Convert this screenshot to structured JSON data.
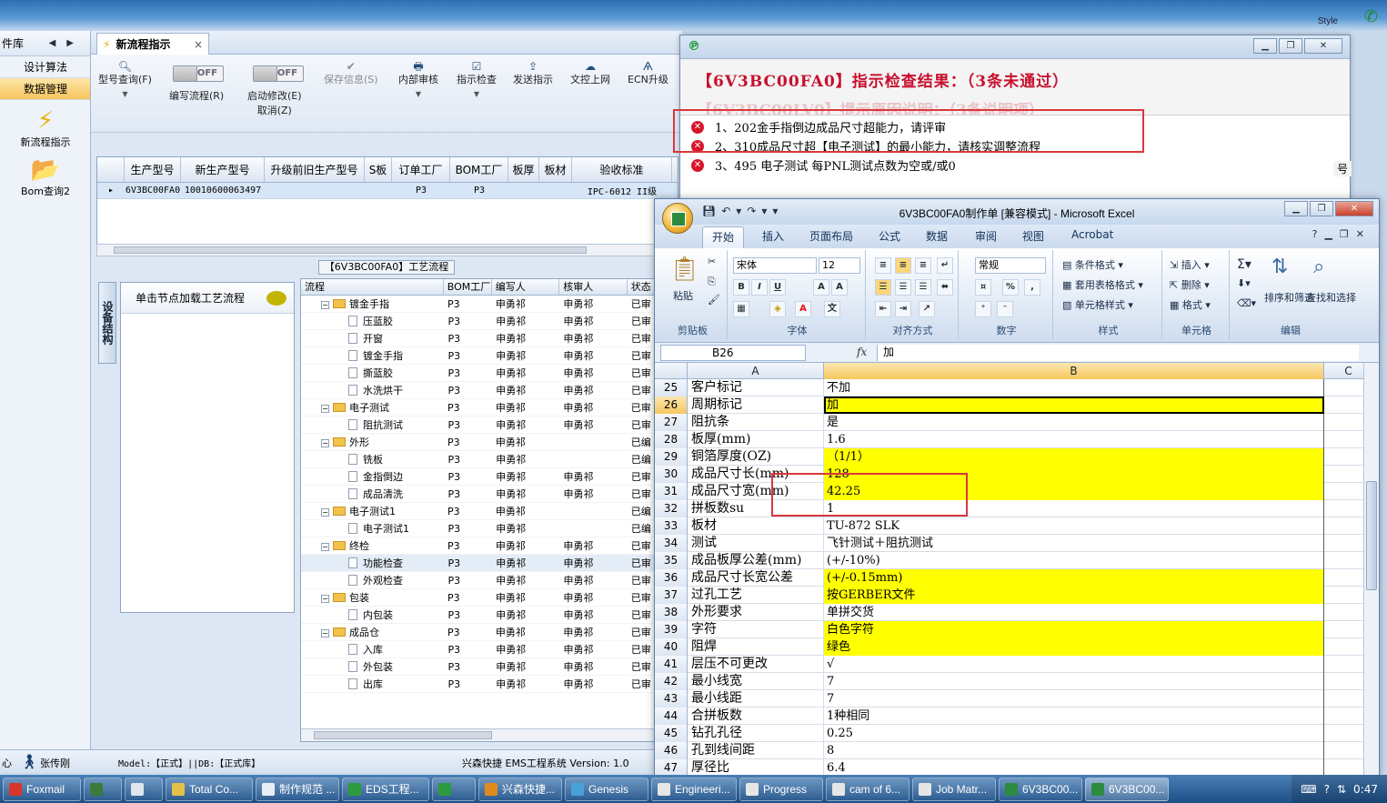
{
  "desktop": {
    "style_label": "Style"
  },
  "leftnav": {
    "header": "件库",
    "items": [
      {
        "label": "设计算法"
      },
      {
        "label": "数据管理"
      }
    ],
    "launchers": [
      {
        "label": "新流程指示"
      },
      {
        "label": "Bom查询2"
      }
    ]
  },
  "main": {
    "tab": {
      "label": "新流程指示",
      "close": "×"
    },
    "toolbar": {
      "model_query": "型号查询(F)",
      "write_flow": "编写流程(R)",
      "toggle_off": "OFF",
      "start_modify": "启动修改(E)",
      "cancel": "取消(Z)",
      "save_info": "保存信息(S)",
      "internal_review": "内部审核",
      "indication_check": "指示检查",
      "send_indication": "发送指示",
      "upload_doc": "文控上网",
      "ecn_upgrade": "ECN升级"
    },
    "upper_grid": {
      "columns": [
        "生产型号",
        "新生产型号",
        "升级前旧生产型号",
        "S板",
        "订单工厂",
        "BOM工厂",
        "板厚",
        "板材",
        "验收标准"
      ],
      "row": [
        "6V3BC00FA0",
        "10010600063497",
        "",
        "",
        "P3",
        "P3",
        "",
        "",
        "IPC-6012 II级"
      ]
    },
    "flow_title": "【6V3BC00FA0】工艺流程",
    "vtab_label": "设备结构",
    "node_hint": "单击节点加载工艺流程",
    "flow_columns": [
      "流程",
      "BOM工厂",
      "编写人",
      "核审人",
      "状态"
    ],
    "flow_rows": [
      {
        "name": "镀金手指",
        "level": 0,
        "bom": "P3",
        "writer": "申勇祁",
        "reviewer": "申勇祁",
        "status": "已审"
      },
      {
        "name": "压蓝胶",
        "level": 1,
        "bom": "P3",
        "writer": "申勇祁",
        "reviewer": "申勇祁",
        "status": "已审"
      },
      {
        "name": "开窗",
        "level": 1,
        "bom": "P3",
        "writer": "申勇祁",
        "reviewer": "申勇祁",
        "status": "已审"
      },
      {
        "name": "镀金手指",
        "level": 1,
        "bom": "P3",
        "writer": "申勇祁",
        "reviewer": "申勇祁",
        "status": "已审"
      },
      {
        "name": "撕蓝胶",
        "level": 1,
        "bom": "P3",
        "writer": "申勇祁",
        "reviewer": "申勇祁",
        "status": "已审"
      },
      {
        "name": "水洗烘干",
        "level": 1,
        "bom": "P3",
        "writer": "申勇祁",
        "reviewer": "申勇祁",
        "status": "已审"
      },
      {
        "name": "电子测试",
        "level": 0,
        "bom": "P3",
        "writer": "申勇祁",
        "reviewer": "申勇祁",
        "status": "已审"
      },
      {
        "name": "阻抗测试",
        "level": 1,
        "bom": "P3",
        "writer": "申勇祁",
        "reviewer": "申勇祁",
        "status": "已审"
      },
      {
        "name": "外形",
        "level": 0,
        "bom": "P3",
        "writer": "申勇祁",
        "reviewer": "",
        "status": "已编"
      },
      {
        "name": "铣板",
        "level": 1,
        "bom": "P3",
        "writer": "申勇祁",
        "reviewer": "",
        "status": "已编"
      },
      {
        "name": "金指倒边",
        "level": 1,
        "bom": "P3",
        "writer": "申勇祁",
        "reviewer": "申勇祁",
        "status": "已审"
      },
      {
        "name": "成品清洗",
        "level": 1,
        "bom": "P3",
        "writer": "申勇祁",
        "reviewer": "申勇祁",
        "status": "已审"
      },
      {
        "name": "电子测试1",
        "level": 0,
        "bom": "P3",
        "writer": "申勇祁",
        "reviewer": "",
        "status": "已编"
      },
      {
        "name": "电子测试1",
        "level": 1,
        "bom": "P3",
        "writer": "申勇祁",
        "reviewer": "",
        "status": "已编"
      },
      {
        "name": "终检",
        "level": 0,
        "bom": "P3",
        "writer": "申勇祁",
        "reviewer": "申勇祁",
        "status": "已审"
      },
      {
        "name": "功能检查",
        "level": 1,
        "bom": "P3",
        "writer": "申勇祁",
        "reviewer": "申勇祁",
        "status": "已审",
        "selected": true
      },
      {
        "name": "外观检查",
        "level": 1,
        "bom": "P3",
        "writer": "申勇祁",
        "reviewer": "申勇祁",
        "status": "已审"
      },
      {
        "name": "包装",
        "level": 0,
        "bom": "P3",
        "writer": "申勇祁",
        "reviewer": "申勇祁",
        "status": "已审"
      },
      {
        "name": "内包装",
        "level": 1,
        "bom": "P3",
        "writer": "申勇祁",
        "reviewer": "申勇祁",
        "status": "已审"
      },
      {
        "name": "成品仓",
        "level": 0,
        "bom": "P3",
        "writer": "申勇祁",
        "reviewer": "申勇祁",
        "status": "已审"
      },
      {
        "name": "入库",
        "level": 1,
        "bom": "P3",
        "writer": "申勇祁",
        "reviewer": "申勇祁",
        "status": "已审"
      },
      {
        "name": "外包装",
        "level": 1,
        "bom": "P3",
        "writer": "申勇祁",
        "reviewer": "申勇祁",
        "status": "已审"
      },
      {
        "name": "出库",
        "level": 1,
        "bom": "P3",
        "writer": "申勇祁",
        "reviewer": "申勇祁",
        "status": "已审"
      }
    ]
  },
  "statusbar": {
    "left": "心",
    "user": "张传刚",
    "model": "Model:【正式】||DB:【正式库】",
    "company": "兴森快捷 EMS工程系统 Version: 1.0"
  },
  "check_dialog": {
    "title_line": "【6V3BC00FA0】指示检查结果：（3条未通过）",
    "ghost_line": "【6V3BC00LV0】提示原因说明：（3条说明项）",
    "issues": [
      "1、202金手指倒边成品尺寸超能力，请评审",
      "2、310成品尺寸超【电子测试】的最小能力，请核实调整流程",
      "3、495 电子测试 每PNL测试点数为空或/或0"
    ],
    "side_label": "号"
  },
  "excel": {
    "title": "6V3BC00FA0制作单 [兼容模式] - Microsoft Excel",
    "tabs": [
      "开始",
      "插入",
      "页面布局",
      "公式",
      "数据",
      "审阅",
      "视图",
      "Acrobat"
    ],
    "ribbon": {
      "paste": "粘贴",
      "clipboard": "剪贴板",
      "font_name": "宋体",
      "font_size": "12",
      "font": "字体",
      "align": "对齐方式",
      "number_format": "常规",
      "number": "数字",
      "cond_format": "条件格式",
      "table_format": "套用表格格式",
      "cell_style": "单元格样式",
      "styles": "样式",
      "insert": "插入",
      "delete": "删除",
      "format": "格式",
      "cells": "单元格",
      "sort_filter": "排序和筛选",
      "find_select": "查找和选择",
      "editing": "编辑"
    },
    "name_box": "B26",
    "formula_value": "加",
    "columns": [
      "A",
      "B",
      "C"
    ],
    "rows": [
      {
        "n": "25",
        "a": "客户标记",
        "b": "不加",
        "y": false
      },
      {
        "n": "26",
        "a": "周期标记",
        "b": "加",
        "y": true,
        "sel": true
      },
      {
        "n": "27",
        "a": "阻抗条",
        "b": "是",
        "y": false
      },
      {
        "n": "28",
        "a": "板厚(mm)",
        "b": "1.6",
        "y": false
      },
      {
        "n": "29",
        "a": "铜箔厚度(OZ)",
        "b": "（1/1）",
        "y": true
      },
      {
        "n": "30",
        "a": "成品尺寸长(mm)",
        "b": "128",
        "y": true
      },
      {
        "n": "31",
        "a": "成品尺寸宽(mm)",
        "b": "42.25",
        "y": true
      },
      {
        "n": "32",
        "a": "拼板数su",
        "b": "1",
        "y": false
      },
      {
        "n": "33",
        "a": "板材",
        "b": "TU-872 SLK",
        "y": false
      },
      {
        "n": "34",
        "a": "测试",
        "b": "飞针测试＋阻抗测试",
        "y": false
      },
      {
        "n": "35",
        "a": "成品板厚公差(mm)",
        "b": "(+/-10%)",
        "y": false
      },
      {
        "n": "36",
        "a": "成品尺寸长宽公差",
        "b": "(+/-0.15mm)",
        "y": true
      },
      {
        "n": "37",
        "a": "过孔工艺",
        "b": "按GERBER文件",
        "y": true
      },
      {
        "n": "38",
        "a": "外形要求",
        "b": "单拼交货",
        "y": false
      },
      {
        "n": "39",
        "a": "字符",
        "b": "白色字符",
        "y": true
      },
      {
        "n": "40",
        "a": "阻焊",
        "b": "绿色",
        "y": true
      },
      {
        "n": "41",
        "a": "层压不可更改",
        "b": "√",
        "y": false
      },
      {
        "n": "42",
        "a": "最小线宽",
        "b": "7",
        "y": false
      },
      {
        "n": "43",
        "a": "最小线距",
        "b": "7",
        "y": false
      },
      {
        "n": "44",
        "a": "合拼板数",
        "b": "1种相同",
        "y": false
      },
      {
        "n": "45",
        "a": "钻孔孔径",
        "b": "0.25",
        "y": false
      },
      {
        "n": "46",
        "a": "孔到线间距",
        "b": "8",
        "y": false
      },
      {
        "n": "47",
        "a": "厚径比",
        "b": "6.4",
        "y": false
      }
    ]
  },
  "taskbar": {
    "items": [
      {
        "label": "Foxmail",
        "color": "#d8362b"
      },
      {
        "label": "",
        "color": "#3b7a3a"
      },
      {
        "label": "",
        "color": "#dfe6ee"
      },
      {
        "label": "Total Co...",
        "color": "#e6c14a"
      },
      {
        "label": "制作规范 ...",
        "color": "#e9eef5"
      },
      {
        "label": "EDS工程...",
        "color": "#2b9b3d"
      },
      {
        "label": "",
        "color": "#2b9b3d"
      },
      {
        "label": "兴森快捷...",
        "color": "#e08a1e"
      },
      {
        "label": "Genesis",
        "color": "#4aa0d8"
      },
      {
        "label": "Engineeri...",
        "color": "#e6e6e6"
      },
      {
        "label": "Progress",
        "color": "#e6e6e6"
      },
      {
        "label": "cam of 6...",
        "color": "#e6e6e6"
      },
      {
        "label": "Job Matr...",
        "color": "#e6e6e6"
      },
      {
        "label": "6V3BC00...",
        "color": "#2c8b3f"
      },
      {
        "label": "6V3BC00...",
        "color": "#2c8b3f",
        "active": true
      }
    ],
    "clock": "0:47"
  }
}
